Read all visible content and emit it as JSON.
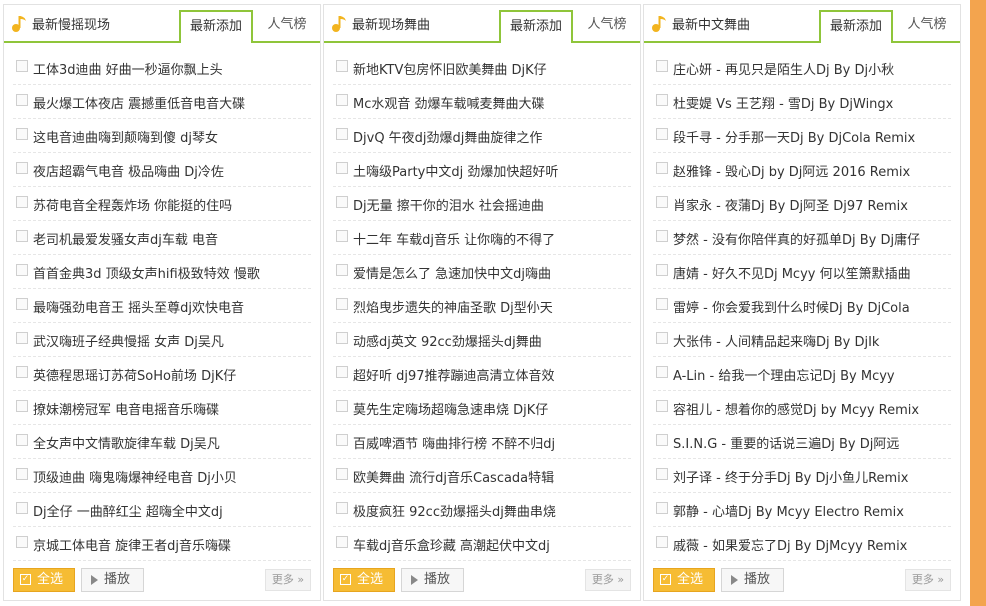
{
  "panels": [
    {
      "title": "最新慢摇现场",
      "tab_new": "最新添加",
      "tab_hot": "人气榜",
      "songs": [
        "工体3d迪曲 好曲一秒逼你飘上头",
        "最火爆工体夜店 震撼重低音电音大碟",
        "这电音迪曲嗨到颠嗨到傻 dj琴女",
        "夜店超霸气电音 极品嗨曲 Dj冷佐",
        "苏荷电音全程轰炸场 你能挺的住吗",
        "老司机最爱发骚女声dj车载 电音",
        "首首金典3d 顶级女声hifi极致特效 慢歌",
        "最嗨强劲电音王 摇头至尊dj欢快电音",
        "武汉嗨班子经典慢摇 女声 Dj吴凡",
        "英德程思瑶订苏荷SoHo前场 DjK仔",
        "撩妹潮榜冠军 电音电摇音乐嗨碟",
        "全女声中文情歌旋律车载 Dj吴凡",
        "顶级迪曲 嗨鬼嗨爆神经电音 Dj小贝",
        "Dj全仔 一曲醉红尘 超嗨全中文dj",
        "京城工体电音 旋律王者dj音乐嗨碟"
      ],
      "select_all": "全选",
      "play": "播放",
      "more": "更多 »"
    },
    {
      "title": "最新现场舞曲",
      "tab_new": "最新添加",
      "tab_hot": "人气榜",
      "songs": [
        "新地KTV包房怀旧欧美舞曲 DjK仔",
        "Mc水观音 劲爆车载喊麦舞曲大碟",
        "DjvQ 午夜dj劲爆dj舞曲旋律之作",
        "土嗨级Party中文dj 劲爆加快超好听",
        "Dj无量 擦干你的泪水 社会摇迪曲",
        "十二年 车载dj音乐 让你嗨的不得了",
        "爱情是怎么了 急速加快中文dj嗨曲",
        "烈焰曳步遗失的神庙圣歌 Dj型仦天",
        "动感dj英文 92cc劲爆摇头dj舞曲",
        "超好听 dj97推荐蹦迪高清立体音效",
        "莫先生定嗨场超嗨急速串烧 DjK仔",
        "百威啤酒节 嗨曲排行榜 不醉不归dj",
        "欧美舞曲 流行dj音乐Cascada特辑",
        "极度疯狂 92cc劲爆摇头dj舞曲串烧",
        "车载dj音乐盒珍藏 高潮起伏中文dj"
      ],
      "select_all": "全选",
      "play": "播放",
      "more": "更多 »"
    },
    {
      "title": "最新中文舞曲",
      "tab_new": "最新添加",
      "tab_hot": "人气榜",
      "songs": [
        "庄心妍 - 再见只是陌生人Dj By Dj小秋",
        "杜雯媞 Vs 王艺翔 - 雪Dj By DjWingx",
        "段千寻 - 分手那一天Dj By DjCola Remix",
        "赵雅锋 - 毁心Dj by Dj阿远 2016 Remix",
        "肖家永 - 夜蒲Dj By Dj阿圣 Dj97 Remix",
        "梦然 - 没有你陪伴真的好孤单Dj By Dj庸仔",
        "唐婧 - 好久不见Dj Mcyy 何以笙箫默插曲",
        "雷婷 - 你会爱我到什么时候Dj By DjCola",
        "大张伟 - 人间精品起来嗨Dj By DjIk",
        "A-Lin - 给我一个理由忘记Dj By Mcyy",
        "容祖儿 - 想着你的感觉Dj by Mcyy Remix",
        "S.I.N.G - 重要的话说三遍Dj By Dj阿远",
        "刘子译 - 终于分手Dj By Dj小鱼儿Remix",
        "郭静 - 心墙Dj By Mcyy Electro Remix",
        "戚薇 - 如果爱忘了Dj By DjMcyy Remix"
      ],
      "select_all": "全选",
      "play": "播放",
      "more": "更多 »"
    }
  ],
  "colors": {
    "accent_green": "#8fc53a",
    "button_orange": "#f6bc33",
    "strip_orange": "#f3a44e"
  }
}
